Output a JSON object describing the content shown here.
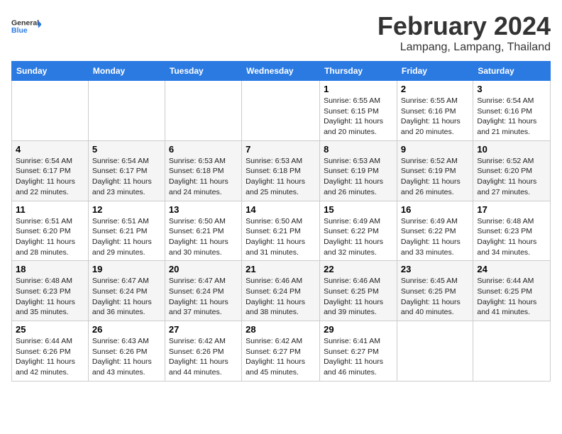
{
  "logo": {
    "text_general": "General",
    "text_blue": "Blue"
  },
  "header": {
    "month": "February 2024",
    "location": "Lampang, Lampang, Thailand"
  },
  "weekdays": [
    "Sunday",
    "Monday",
    "Tuesday",
    "Wednesday",
    "Thursday",
    "Friday",
    "Saturday"
  ],
  "weeks": [
    [
      {
        "day": "",
        "info": ""
      },
      {
        "day": "",
        "info": ""
      },
      {
        "day": "",
        "info": ""
      },
      {
        "day": "",
        "info": ""
      },
      {
        "day": "1",
        "info": "Sunrise: 6:55 AM\nSunset: 6:15 PM\nDaylight: 11 hours and 20 minutes."
      },
      {
        "day": "2",
        "info": "Sunrise: 6:55 AM\nSunset: 6:16 PM\nDaylight: 11 hours and 20 minutes."
      },
      {
        "day": "3",
        "info": "Sunrise: 6:54 AM\nSunset: 6:16 PM\nDaylight: 11 hours and 21 minutes."
      }
    ],
    [
      {
        "day": "4",
        "info": "Sunrise: 6:54 AM\nSunset: 6:17 PM\nDaylight: 11 hours and 22 minutes."
      },
      {
        "day": "5",
        "info": "Sunrise: 6:54 AM\nSunset: 6:17 PM\nDaylight: 11 hours and 23 minutes."
      },
      {
        "day": "6",
        "info": "Sunrise: 6:53 AM\nSunset: 6:18 PM\nDaylight: 11 hours and 24 minutes."
      },
      {
        "day": "7",
        "info": "Sunrise: 6:53 AM\nSunset: 6:18 PM\nDaylight: 11 hours and 25 minutes."
      },
      {
        "day": "8",
        "info": "Sunrise: 6:53 AM\nSunset: 6:19 PM\nDaylight: 11 hours and 26 minutes."
      },
      {
        "day": "9",
        "info": "Sunrise: 6:52 AM\nSunset: 6:19 PM\nDaylight: 11 hours and 26 minutes."
      },
      {
        "day": "10",
        "info": "Sunrise: 6:52 AM\nSunset: 6:20 PM\nDaylight: 11 hours and 27 minutes."
      }
    ],
    [
      {
        "day": "11",
        "info": "Sunrise: 6:51 AM\nSunset: 6:20 PM\nDaylight: 11 hours and 28 minutes."
      },
      {
        "day": "12",
        "info": "Sunrise: 6:51 AM\nSunset: 6:21 PM\nDaylight: 11 hours and 29 minutes."
      },
      {
        "day": "13",
        "info": "Sunrise: 6:50 AM\nSunset: 6:21 PM\nDaylight: 11 hours and 30 minutes."
      },
      {
        "day": "14",
        "info": "Sunrise: 6:50 AM\nSunset: 6:21 PM\nDaylight: 11 hours and 31 minutes."
      },
      {
        "day": "15",
        "info": "Sunrise: 6:49 AM\nSunset: 6:22 PM\nDaylight: 11 hours and 32 minutes."
      },
      {
        "day": "16",
        "info": "Sunrise: 6:49 AM\nSunset: 6:22 PM\nDaylight: 11 hours and 33 minutes."
      },
      {
        "day": "17",
        "info": "Sunrise: 6:48 AM\nSunset: 6:23 PM\nDaylight: 11 hours and 34 minutes."
      }
    ],
    [
      {
        "day": "18",
        "info": "Sunrise: 6:48 AM\nSunset: 6:23 PM\nDaylight: 11 hours and 35 minutes."
      },
      {
        "day": "19",
        "info": "Sunrise: 6:47 AM\nSunset: 6:24 PM\nDaylight: 11 hours and 36 minutes."
      },
      {
        "day": "20",
        "info": "Sunrise: 6:47 AM\nSunset: 6:24 PM\nDaylight: 11 hours and 37 minutes."
      },
      {
        "day": "21",
        "info": "Sunrise: 6:46 AM\nSunset: 6:24 PM\nDaylight: 11 hours and 38 minutes."
      },
      {
        "day": "22",
        "info": "Sunrise: 6:46 AM\nSunset: 6:25 PM\nDaylight: 11 hours and 39 minutes."
      },
      {
        "day": "23",
        "info": "Sunrise: 6:45 AM\nSunset: 6:25 PM\nDaylight: 11 hours and 40 minutes."
      },
      {
        "day": "24",
        "info": "Sunrise: 6:44 AM\nSunset: 6:25 PM\nDaylight: 11 hours and 41 minutes."
      }
    ],
    [
      {
        "day": "25",
        "info": "Sunrise: 6:44 AM\nSunset: 6:26 PM\nDaylight: 11 hours and 42 minutes."
      },
      {
        "day": "26",
        "info": "Sunrise: 6:43 AM\nSunset: 6:26 PM\nDaylight: 11 hours and 43 minutes."
      },
      {
        "day": "27",
        "info": "Sunrise: 6:42 AM\nSunset: 6:26 PM\nDaylight: 11 hours and 44 minutes."
      },
      {
        "day": "28",
        "info": "Sunrise: 6:42 AM\nSunset: 6:27 PM\nDaylight: 11 hours and 45 minutes."
      },
      {
        "day": "29",
        "info": "Sunrise: 6:41 AM\nSunset: 6:27 PM\nDaylight: 11 hours and 46 minutes."
      },
      {
        "day": "",
        "info": ""
      },
      {
        "day": "",
        "info": ""
      }
    ]
  ]
}
